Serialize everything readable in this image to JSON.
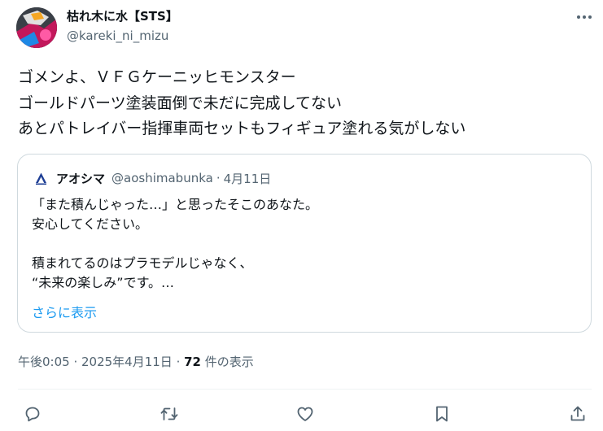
{
  "author": {
    "display_name": "枯れ木に水【STS】",
    "handle": "@kareki_ni_mizu"
  },
  "tweet": {
    "lines": [
      "ゴメンよ、ＶＦＧケーニッヒモンスター",
      "ゴールドパーツ塗装面倒で未だに完成してない",
      "あとパトレイバー指揮車両セットもフィギュア塗れる気がしない"
    ]
  },
  "quote": {
    "display_name": "アオシマ",
    "handle": "@aoshimabunka",
    "separator": "·",
    "date": "4月11日",
    "lines": [
      "「また積んじゃった…」と思ったそこのあなた。",
      "安心してください。",
      "",
      "積まれてるのはプラモデルじゃなく、",
      "“未来の楽しみ”です。…"
    ],
    "show_more": "さらに表示"
  },
  "meta": {
    "time": "午後0:05",
    "sep1": " · ",
    "date": "2025年4月11日",
    "sep2": " · ",
    "views": "72",
    "views_label": " 件の表示"
  },
  "icons": {
    "more": "more-horizontal-icon",
    "reply": "reply-icon",
    "retweet": "retweet-icon",
    "like": "heart-icon",
    "bookmark": "bookmark-icon",
    "share": "share-icon"
  },
  "colors": {
    "text_primary": "#0f1419",
    "text_secondary": "#536471",
    "link": "#1d9bf0",
    "border": "#cfd9de",
    "quote_logo": "#1f3f95"
  }
}
